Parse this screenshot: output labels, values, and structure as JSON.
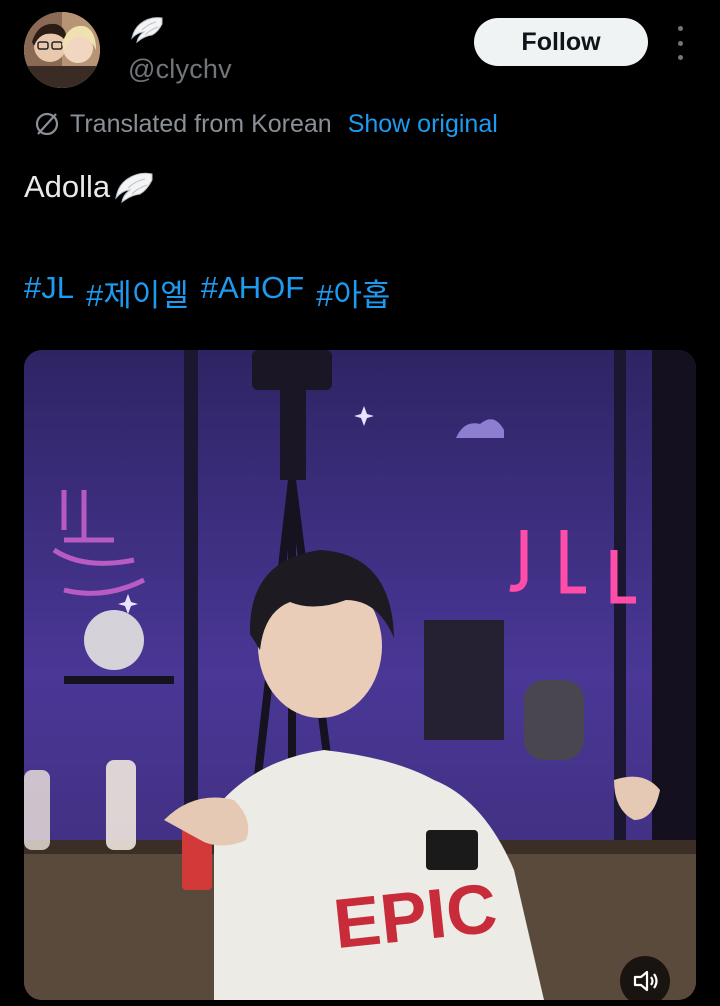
{
  "author": {
    "display_name_icon": "angel-wing-icon",
    "handle": "@clychv",
    "avatar": "profile-photo"
  },
  "actions": {
    "follow_label": "Follow",
    "more_icon": "more-vertical-icon"
  },
  "translation": {
    "icon": "translate-globe-icon",
    "label": "Translated from Korean",
    "show_original_label": "Show original"
  },
  "tweet": {
    "text": "Adolla",
    "text_icon": "angel-wing-icon",
    "hashtags": [
      "#JL",
      "#제이엘",
      "#AHOF",
      "#아홉"
    ]
  },
  "media": {
    "type": "video",
    "sound_icon": "speaker-muted-icon"
  },
  "colors": {
    "background": "#000000",
    "text": "#e7e9ea",
    "secondary": "#71767b",
    "link": "#1d9bf0",
    "follow_bg": "#eff3f4"
  }
}
